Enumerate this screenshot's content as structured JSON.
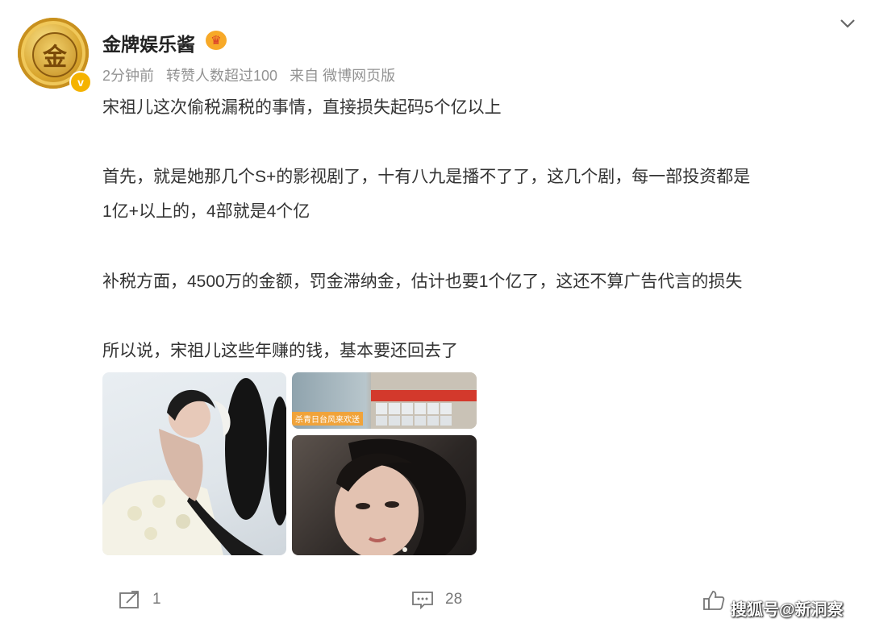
{
  "post": {
    "username": "金牌娱乐酱",
    "avatar_glyph": "金",
    "verified_badge": "v",
    "meta": {
      "time": "2分钟前",
      "reposts_note": "转赞人数超过100",
      "source": "来自 微博网页版"
    },
    "paragraphs": [
      "宋祖儿这次偷税漏税的事情，直接损失起码5个亿以上",
      "首先，就是她那几个S+的影视剧了，十有八九是播不了了，这几个剧，每一部投资都是",
      "1亿+以上的，4部就是4个亿",
      "补税方面，4500万的金额，罚金滞纳金，估计也要1个亿了，这还不算广告代言的损失",
      "所以说，宋祖儿这些年赚的钱，基本要还回去了"
    ],
    "image_banner_text": "杀青日台风来欢送",
    "actions": {
      "repost_count": "1",
      "comment_count": "28"
    }
  },
  "watermark": "搜狐号@新洞察",
  "icons": {
    "menu": "chevron-down-icon",
    "crown": "crown-icon",
    "repost": "repost-icon",
    "comment": "comment-icon",
    "like": "thumbs-up-icon"
  },
  "colors": {
    "text": "#333333",
    "meta": "#939393",
    "badge": "#f5b300"
  }
}
